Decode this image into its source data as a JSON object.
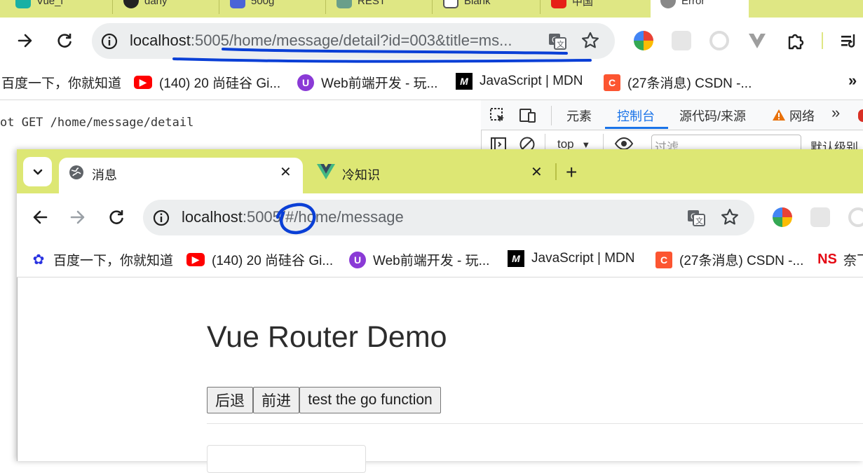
{
  "back_window": {
    "tabs": [
      "Vue_i",
      "dany",
      "500g",
      "REST",
      "Blank",
      "中国",
      "Error"
    ],
    "address": {
      "host": "localhost",
      "rest": ":5005/home/message/detail?id=003&title=ms..."
    },
    "bookmarks": [
      {
        "label": "百度一下，你就知道",
        "icon": "baidu-icon"
      },
      {
        "label": "(140) 20 尚硅谷 Gi...",
        "icon": "youtube-icon"
      },
      {
        "label": "Web前端开发 - 玩...",
        "icon": "web-icon"
      },
      {
        "label": "JavaScript | MDN",
        "icon": "mdn-icon"
      },
      {
        "label": "(27条消息) CSDN -...",
        "icon": "csdn-icon"
      }
    ],
    "more_bookmarks": "»",
    "page_text": "ot GET /home/message/detail",
    "devtools": {
      "tabs": [
        "元素",
        "控制台",
        "源代码/来源",
        "网络"
      ],
      "active_tab": "控制台",
      "context": "top",
      "filter_placeholder": "过滤",
      "level": "默认级别"
    }
  },
  "front_window": {
    "tabs": [
      {
        "title": "消息",
        "icon": "globe-icon"
      },
      {
        "title": "冷知识",
        "icon": "vue-icon"
      }
    ],
    "address": {
      "host": "localhost",
      "rest": ":5005/#/home/message"
    },
    "bookmarks": [
      {
        "label": "百度一下，你就知道",
        "icon": "baidu-icon"
      },
      {
        "label": "(140) 20 尚硅谷 Gi...",
        "icon": "youtube-icon"
      },
      {
        "label": "Web前端开发 - 玩...",
        "icon": "web-icon"
      },
      {
        "label": "JavaScript | MDN",
        "icon": "mdn-icon"
      },
      {
        "label": "(27条消息) CSDN -...",
        "icon": "csdn-icon"
      },
      {
        "label": "奈飞",
        "icon": "ns-icon"
      }
    ],
    "page": {
      "title": "Vue Router Demo",
      "buttons": [
        "后退",
        "前进",
        "test the go function"
      ]
    }
  },
  "colors": {
    "tabstrip": "#dde774",
    "annotation": "#0a3fd6",
    "devtools_accent": "#1a73e8"
  }
}
